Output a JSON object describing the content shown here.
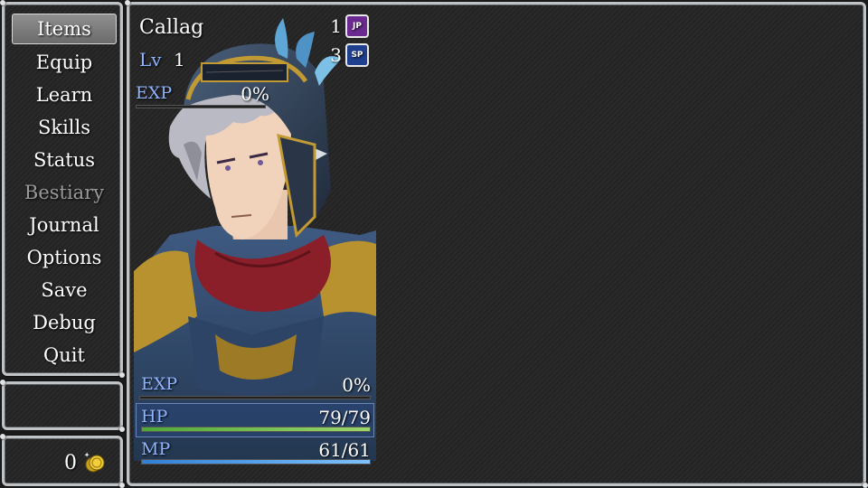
{
  "menu": {
    "items": [
      {
        "label": "Items",
        "state": "selected"
      },
      {
        "label": "Equip",
        "state": "normal"
      },
      {
        "label": "Learn",
        "state": "normal"
      },
      {
        "label": "Skills",
        "state": "normal"
      },
      {
        "label": "Status",
        "state": "normal"
      },
      {
        "label": "Bestiary",
        "state": "disabled"
      },
      {
        "label": "Journal",
        "state": "normal"
      },
      {
        "label": "Options",
        "state": "normal"
      },
      {
        "label": "Save",
        "state": "normal"
      },
      {
        "label": "Debug",
        "state": "normal"
      },
      {
        "label": "Quit",
        "state": "normal"
      }
    ]
  },
  "gold": {
    "value": "0",
    "icon": "gold-coin-icon"
  },
  "actor": {
    "name": "Callag",
    "level_label": "Lv",
    "level": "1",
    "jp": {
      "value": "1",
      "badge": "JP",
      "color": "#6b2a8f"
    },
    "sp": {
      "value": "3",
      "badge": "SP",
      "color": "#1f3f8f"
    },
    "top_exp": {
      "label": "EXP",
      "value": "0%",
      "fraction": 0
    },
    "exp": {
      "label": "EXP",
      "value": "0%",
      "fraction": 0
    },
    "hp": {
      "label": "HP",
      "value": "79/79",
      "fraction": 1.0,
      "color_start": "#4fa83a",
      "color_end": "#9bd66a"
    },
    "mp": {
      "label": "MP",
      "value": "61/61",
      "fraction": 1.0,
      "color_start": "#2f7fd6",
      "color_end": "#7cc3ff"
    }
  }
}
